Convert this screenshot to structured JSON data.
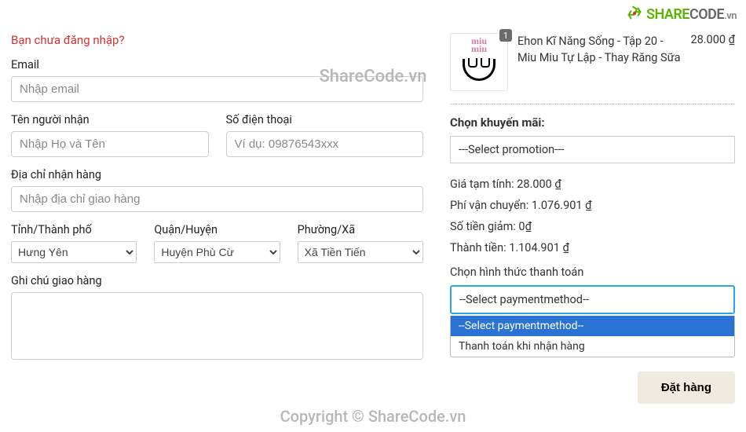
{
  "brand": {
    "part1": "SHARE",
    "part2": "CODE",
    "suffix": ".vn"
  },
  "watermark_center": "ShareCode.vn",
  "watermark_bottom": "Copyright © ShareCode.vn",
  "login_hint": "Bạn chưa đăng nhập?",
  "fields": {
    "email": {
      "label": "Email",
      "placeholder": "Nhập email"
    },
    "name": {
      "label": "Tên người nhận",
      "placeholder": "Nhập Họ và Tên"
    },
    "phone": {
      "label": "Số điện thoại",
      "placeholder": "Ví dụ: 09876543xxx"
    },
    "address": {
      "label": "Địa chỉ nhận hàng",
      "placeholder": "Nhập địa chỉ giao hàng"
    },
    "province": {
      "label": "Tỉnh/Thành phố",
      "value": "Hưng Yên"
    },
    "district": {
      "label": "Quận/Huyện",
      "value": "Huyện Phù Cừ"
    },
    "ward": {
      "label": "Phường/Xã",
      "value": "Xã Tiền Tiến"
    },
    "note": {
      "label": "Ghi chú giao hàng"
    }
  },
  "cart": {
    "item": {
      "title": "Ehon Kĩ Năng Sống - Tập 20 - Miu Miu Tự Lập - Thay Răng Sữa",
      "price": "28.000 ₫",
      "qty": "1",
      "thumb_text": "miu\nmiu"
    }
  },
  "promo": {
    "label": "Chọn khuyến mãi:",
    "placeholder": "---Select promotion---"
  },
  "summary": {
    "subtotal": "Giá tạm tính: 28.000 ₫",
    "shipping": "Phí vận chuyển: 1.076.901 ₫",
    "discount": "Số tiền giảm: 0₫",
    "total": "Thành tiền: 1.104.901 ₫"
  },
  "payment": {
    "label": "Chọn hình thức thanh toán",
    "selected": "--Select paymentmethod--",
    "options": [
      "--Select paymentmethod--",
      "Thanh toán khi nhận hàng"
    ]
  },
  "order_button": "Đặt hàng"
}
